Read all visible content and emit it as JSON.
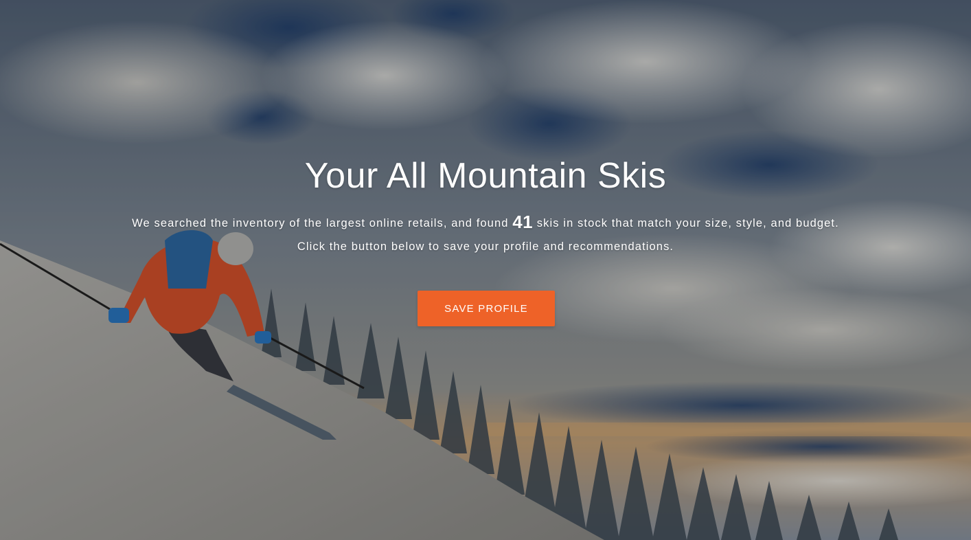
{
  "hero": {
    "title": "Your All Mountain Skis",
    "line1_before": "We searched the inventory of the largest online retails, and found ",
    "count": "41",
    "line1_after": " skis in stock that match your size, style, and budget.",
    "line2": "Click the button below to save your profile and recommendations.",
    "button_label": "SAVE PROFILE"
  },
  "colors": {
    "accent": "#ee6228",
    "text": "#ffffff"
  },
  "background_image": "skier-descending-snowy-slope-photo"
}
